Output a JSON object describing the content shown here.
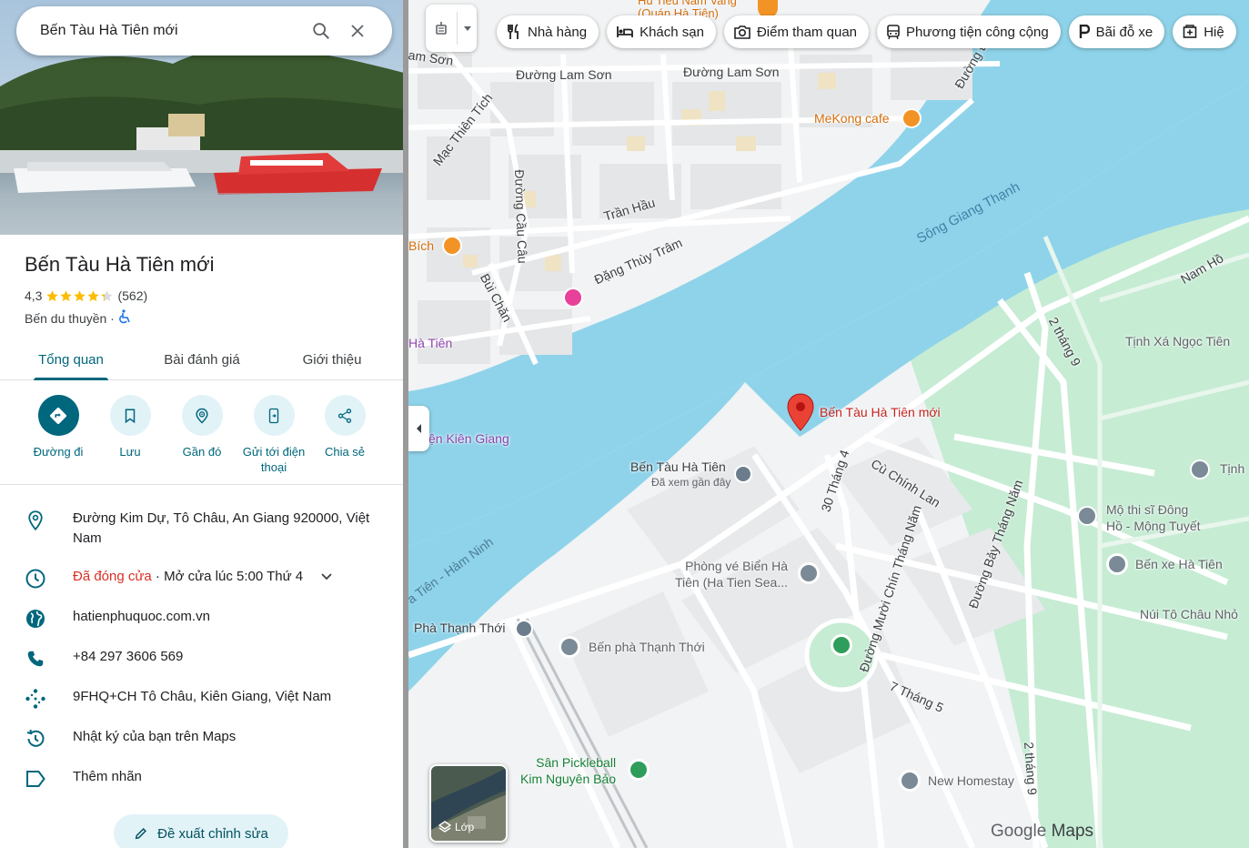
{
  "search": {
    "query": "Bến Tàu Hà Tiên mới"
  },
  "place": {
    "name": "Bến Tàu Hà Tiên mới",
    "rating": "4,3",
    "stars_value": 4.3,
    "review_count": "(562)",
    "category": "Bến du thuyền ·"
  },
  "tabs": [
    {
      "label": "Tổng quan",
      "active": true
    },
    {
      "label": "Bài đánh giá",
      "active": false
    },
    {
      "label": "Giới thiệu",
      "active": false
    }
  ],
  "actions": [
    {
      "label": "Đường đi",
      "icon": "directions-icon"
    },
    {
      "label": "Lưu",
      "icon": "bookmark-icon"
    },
    {
      "label": "Gần đó",
      "icon": "nearby-icon"
    },
    {
      "label": "Gửi tới điện thoại",
      "icon": "send-to-phone-icon"
    },
    {
      "label": "Chia sẻ",
      "icon": "share-icon"
    }
  ],
  "info": {
    "address": "Đường Kim Dự, Tô Châu, An Giang 920000, Việt Nam",
    "hours_status": "Đã đóng cửa",
    "hours_next": " · Mở cửa lúc 5:00 Thứ 4",
    "website": "hatienphuquoc.com.vn",
    "phone": "+84 297 3606 569",
    "plus_code": "9FHQ+CH Tô Châu, Kiên Giang, Việt Nam",
    "history": "Nhật ký của bạn trên Maps",
    "add_label": "Thêm nhãn"
  },
  "suggest_edit": "Đề xuất chỉnh sửa",
  "chips": [
    {
      "label": "Nhà hàng",
      "icon": "restaurant-icon"
    },
    {
      "label": "Khách sạn",
      "icon": "hotel-icon"
    },
    {
      "label": "Điểm tham quan",
      "icon": "camera-icon"
    },
    {
      "label": "Phương tiện công cộng",
      "icon": "transit-icon"
    },
    {
      "label": "Bãi đỗ xe",
      "icon": "parking-icon"
    },
    {
      "label": "Hiệ",
      "icon": "pharmacy-icon"
    }
  ],
  "layers_label": "Lớp",
  "map": {
    "roads": {
      "lam_son_1": "Đường Lam Sơn",
      "lam_son_2": "Đường Lam Sơn",
      "mac_thien_tich": "Mạc Thiên Tích",
      "cau_cau": "Đường Cầu Câu",
      "tran_hau": "Trần Hầu",
      "dang_thuy_tram": "Đặng Thùy Trâm",
      "bui_chan": "Bùi Chăn",
      "nam_ho": "Nam Hồ",
      "hai_thang_chin_1": "2 tháng 9",
      "hai_thang_chin_2": "2 tháng 9",
      "ba_muoi_thang_tu": "30 Tháng 4",
      "cu_chinh_lan": "Cù Chính Lan",
      "muoi_chin_thang_nam": "Đường Mười Chín Tháng Năm",
      "bay_thang_nam": "Đường Bảy Tháng Năm",
      "bay_thang_nam_short": "7 Tháng 5",
      "am_son": "am Sơn",
      "duong_top": "Đường Đ",
      "ha_tien_ham_ninh": "a Tiên - Hàm Ninh"
    },
    "water": "Sông Giang Thạnh",
    "pois": {
      "tiem_top": "Hủ Tiếu Nam Vang",
      "tiem_top_sub": "(Quán Hà Tiên)",
      "mekong_cafe": "MeKong cafe",
      "bich": "Bích",
      "ha_tien_left": "Hà Tiên",
      "kien_giang": "ện Kiên Giang",
      "ben_tau_new": "Bến Tàu Hà Tiên mới",
      "ben_tau": "Bến Tàu Hà Tiên",
      "ben_tau_sub": "Đã xem gần đây",
      "tinh_xa": "Tịnh Xá Ngọc Tiên",
      "tinh": "Tịnh",
      "mo_thi_si": "Mộ thi sĩ Đông Hồ - Mộng Tuyết",
      "mo_thi_si_1": "Mộ thi sĩ Đông",
      "mo_thi_si_2": "Hồ - Mộng Tuyết",
      "phong_ve_1": "Phòng vé Biển Hà",
      "phong_ve_2": "Tiên (Ha Tien Sea...",
      "ben_xe": "Bến xe Hà Tiên",
      "nui_to_chau": "Núi Tô Châu Nhỏ",
      "pha_thanh_thoi": "Phà Thạnh Thới",
      "ben_pha": "Bến phà Thạnh Thới",
      "pickleball_1": "Sân Pickleball",
      "pickleball_2": "Kim Nguyên Bảo",
      "new_homestay": "New Homestay"
    }
  },
  "branding": {
    "google": "Google",
    "maps": "Maps"
  },
  "colors": {
    "accent": "#00677d",
    "water": "#8fd3ea",
    "park": "#c6ecd4",
    "closed": "#d93025",
    "pin": "#ea4335"
  }
}
